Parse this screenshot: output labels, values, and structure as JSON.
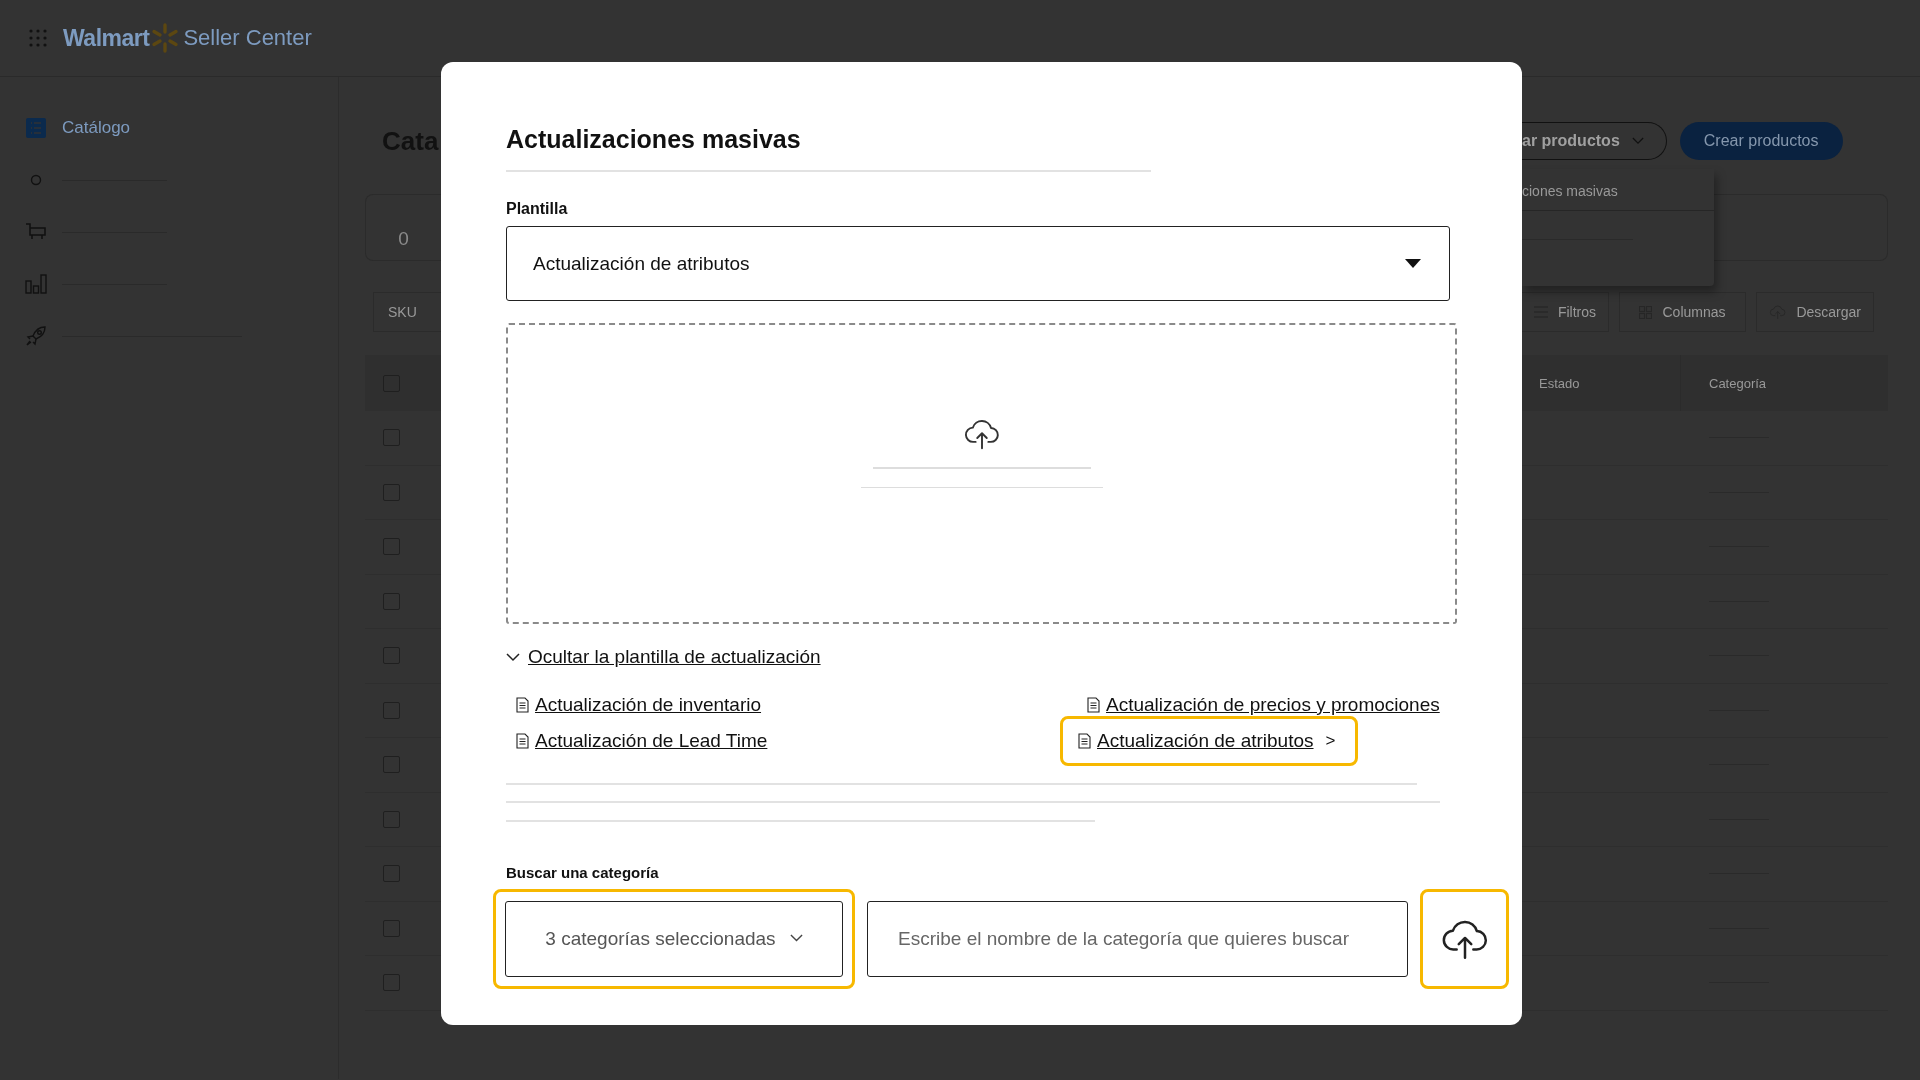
{
  "header": {
    "logo_text": "Walmart",
    "product": "Seller Center"
  },
  "sidebar": {
    "items": [
      {
        "kind": "catalog",
        "label": "Catálogo",
        "selected": true
      },
      {
        "kind": "circle",
        "selected": false
      },
      {
        "kind": "cart",
        "selected": false
      },
      {
        "kind": "chart",
        "selected": false
      },
      {
        "kind": "rocket",
        "selected": false
      }
    ]
  },
  "page": {
    "title": "Cata",
    "stat_card": {
      "value": "0"
    },
    "sku_field": {
      "label": "SKU"
    },
    "actions": [
      {
        "kind": "outline",
        "label": "ar productos"
      },
      {
        "kind": "primary",
        "label": "Crear productos"
      }
    ],
    "menu": {
      "items": [
        "ciones masivas"
      ]
    },
    "toolbar": [
      {
        "kind": "filter",
        "label": "Filtros"
      },
      {
        "kind": "columns",
        "label": "Columnas"
      },
      {
        "kind": "download",
        "label": "Descargar"
      }
    ],
    "table": {
      "select_all": {
        "checked": false
      },
      "columns": [
        "Estado",
        "Categoría"
      ],
      "rows": [
        {
          "checked": false
        },
        {
          "checked": false
        },
        {
          "checked": false
        },
        {
          "checked": false
        },
        {
          "checked": false
        },
        {
          "checked": false
        },
        {
          "checked": false
        },
        {
          "checked": false
        },
        {
          "checked": false
        },
        {
          "checked": false
        },
        {
          "checked": false
        }
      ]
    }
  },
  "dialog": {
    "title": "Actualizaciones masivas",
    "template_label": "Plantilla",
    "template_value": "Actualización de atributos",
    "toggle_link": {
      "label": "Ocultar la plantilla de actualización",
      "expanded": true
    },
    "templates": [
      {
        "label": "Actualización de inventario",
        "highlighted": false
      },
      {
        "label": "Actualización de precios y promociones",
        "highlighted": false
      },
      {
        "label": "Actualización de Lead Time",
        "highlighted": false
      },
      {
        "label": "Actualización de atributos",
        "highlighted": true,
        "arrow": ">"
      }
    ],
    "category_label": "Buscar una categoría",
    "category_select": {
      "value": "3 categorías seleccionadas",
      "highlighted": true
    },
    "category_search": {
      "placeholder": "Escribe el nombre de la categoría que quieres buscar",
      "highlighted": false
    },
    "upload_button": {
      "highlighted": true
    }
  }
}
